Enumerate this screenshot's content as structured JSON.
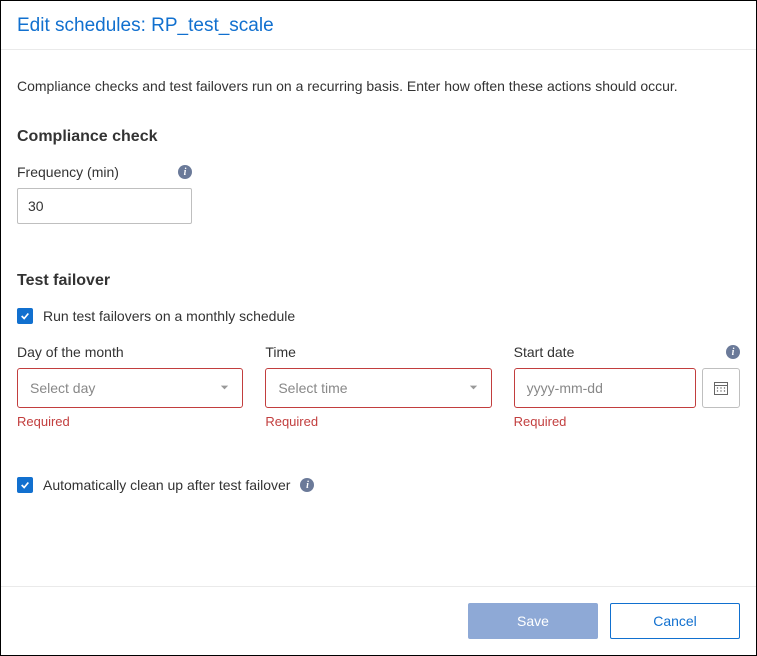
{
  "header": {
    "title": "Edit schedules: RP_test_scale"
  },
  "intro": "Compliance checks and test failovers run on a recurring basis. Enter how often these actions should occur.",
  "compliance": {
    "section_title": "Compliance check",
    "frequency_label": "Frequency (min)",
    "frequency_value": "30"
  },
  "failover": {
    "section_title": "Test failover",
    "run_monthly_label": "Run test failovers on a monthly schedule",
    "run_monthly_checked": true,
    "day_label": "Day of the month",
    "day_placeholder": "Select day",
    "time_label": "Time",
    "time_placeholder": "Select time",
    "startdate_label": "Start date",
    "startdate_placeholder": "yyyy-mm-dd",
    "required_text": "Required",
    "cleanup_label": "Automatically clean up after test failover",
    "cleanup_checked": true
  },
  "footer": {
    "save": "Save",
    "cancel": "Cancel"
  }
}
